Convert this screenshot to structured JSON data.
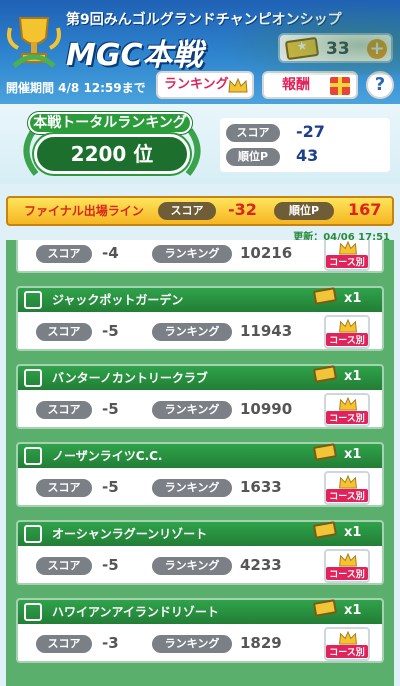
{
  "header": {
    "event_title": "第9回みんゴルグランドチャンピオンシップ",
    "main_title": "MGC本戦",
    "ticket_count": "33",
    "plus_label": "+",
    "period": "開催期間 4/8 12:59まで",
    "ranking_button": "ランキング",
    "reward_button": "報酬",
    "help_button": "?"
  },
  "total": {
    "label": "本戦トータルランキング",
    "rank": "2200 位",
    "score_label": "スコア",
    "score_value": "-27",
    "points_label": "順位P",
    "points_value": "43"
  },
  "final_line": {
    "label": "ファイナル出場ライン",
    "score_label": "スコア",
    "score_value": "-32",
    "points_label": "順位P",
    "points_value": "167",
    "updated": "更新：04/06 17:51"
  },
  "labels": {
    "score": "スコア",
    "ranking": "ランキング",
    "course_button": "コース別",
    "multiplier": "x1"
  },
  "partial_row": {
    "score": "-4",
    "ranking": "10216"
  },
  "courses": [
    {
      "name": "ジャックポットガーデン",
      "score": "-5",
      "ranking": "11943",
      "icon": "tree-icon"
    },
    {
      "name": "バンターノカントリークラブ",
      "score": "-5",
      "ranking": "10990",
      "icon": "wave-icon"
    },
    {
      "name": "ノーザンライツC.C.",
      "score": "-5",
      "ranking": "1633",
      "icon": "mountain-icon"
    },
    {
      "name": "オーシャンラグーンリゾート",
      "score": "-5",
      "ranking": "4233",
      "icon": "sailboat-icon"
    },
    {
      "name": "ハワイアンアイランドリゾート",
      "score": "-3",
      "ranking": "1829",
      "icon": "palm-icon"
    }
  ],
  "colors": {
    "header_blue": "#1f61b4",
    "green": "#2fa34a",
    "accent_red": "#e0245b",
    "score_blue": "#1d3f8c"
  }
}
